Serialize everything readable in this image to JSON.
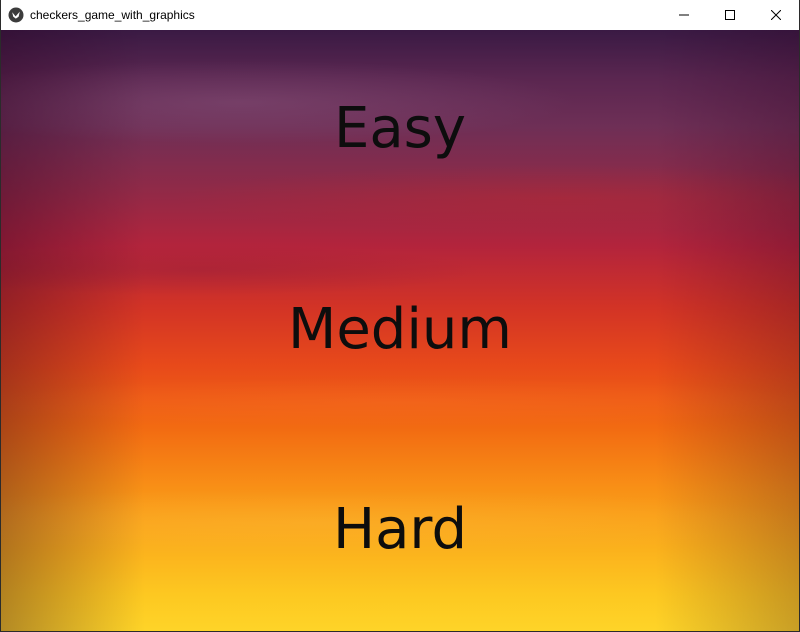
{
  "window": {
    "title": "checkers_game_with_graphics",
    "app_icon": "kivy-logo-icon",
    "controls": {
      "minimize_icon": "minimize-icon",
      "maximize_icon": "maximize-icon",
      "close_icon": "close-icon"
    }
  },
  "menu": {
    "options": [
      {
        "label": "Easy"
      },
      {
        "label": "Medium"
      },
      {
        "label": "Hard"
      }
    ]
  },
  "colors": {
    "text": "#0d0d0d",
    "sky_top": "#3a1a44",
    "sky_middle": "#d23326",
    "sky_bottom": "#fed428"
  }
}
